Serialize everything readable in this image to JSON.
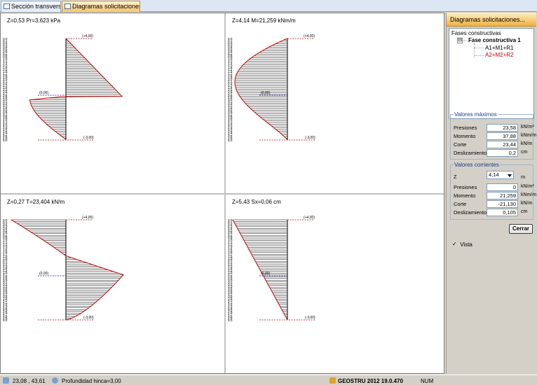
{
  "tabs": [
    {
      "label": "Sección transversal",
      "active": false
    },
    {
      "label": "Diagramas solicitaciones..",
      "active": true
    }
  ],
  "depth_labels": [
    "0,0",
    "0,1",
    "0,2",
    "0,3",
    "0,4",
    "0,5",
    "0,6",
    "0,7",
    "0,8",
    "0,9",
    "1,0",
    "1,1",
    "1,2",
    "1,3",
    "1,4",
    "1,5",
    "1,6",
    "1,7",
    "1,8",
    "1,9",
    "2,0",
    "2,1",
    "2,2",
    "2,3",
    "2,4",
    "2,5",
    "2,6",
    "2,7",
    "2,8",
    "2,9",
    "3,0",
    "3,1",
    "3,2",
    "3,3",
    "3,4",
    "3,5",
    "3,6",
    "3,7",
    "3,8",
    "3,9",
    "4,0",
    "4,1",
    "4,2",
    "4,3",
    "4,4",
    "4,5",
    "4,6",
    "4,7",
    "4,8",
    "4,9",
    "5,0"
  ],
  "diagrams": [
    {
      "title": "Z=0,53 Pr=3,623 kPa",
      "top_marker": "(+4,00)",
      "mid_marker": "(0,00)",
      "bottom_marker": "(-3,00)"
    },
    {
      "title": "Z=4,14 M=21,259 kNm/m",
      "top_marker": "(+4,00)",
      "mid_marker": "(0,00)",
      "bottom_marker": "(-3,00)"
    },
    {
      "title": "Z=0,27 T=23,404 kN/m",
      "top_marker": "(+4,00)",
      "mid_marker": "(0,00)",
      "bottom_marker": "(-3,00)"
    },
    {
      "title": "Z=5,43 Sx=0,06 cm",
      "top_marker": "(+4,00)",
      "mid_marker": "(0,00)",
      "bottom_marker": "(-3,00)"
    }
  ],
  "panel": {
    "title": "Diagramas solicitaciones...",
    "tree": {
      "root": "Fases constructivas",
      "phase": "Fase constructiva 1",
      "items": [
        {
          "label": "A1+M1+R1",
          "color": "#000000"
        },
        {
          "label": "A2+M2+R2",
          "color": "#c00000"
        }
      ],
      "expander": "⊟"
    },
    "max_values": {
      "legend": "Valores máximos",
      "rows": [
        {
          "label": "Presiones",
          "value": "23,58",
          "unit": "kN/m²"
        },
        {
          "label": "Momento",
          "value": "37,88",
          "unit": "kNm/m"
        },
        {
          "label": "Corte",
          "value": "23,44",
          "unit": "kN/m"
        },
        {
          "label": "Deslizamiento",
          "value": "0,2",
          "unit": "cm"
        }
      ]
    },
    "current_values": {
      "legend": "Valores corrientes",
      "z_label": "Z",
      "z_value": "4,14",
      "z_unit": "m",
      "rows": [
        {
          "label": "Presiones",
          "value": "0",
          "unit": "kN/m²"
        },
        {
          "label": "Momento",
          "value": "21,259",
          "unit": "kNm/m"
        },
        {
          "label": "Corte",
          "value": "-21,130",
          "unit": "kN/m"
        },
        {
          "label": "Deslizamiento",
          "value": "0,105",
          "unit": "cm"
        }
      ]
    },
    "close_button": "Cerrar",
    "view_checkbox": {
      "label": "Vista",
      "checked": true,
      "mark": "✓"
    }
  },
  "status": {
    "coords": "23,08 , 43,61",
    "depth": "Profundidad hinca=3,00",
    "app": "GEOSTRU 2012 19.0.470",
    "num": "NUM"
  },
  "colors": {
    "diagram_curve": "#c00000",
    "hatch": "#000000",
    "marker_line": "#c00000",
    "mid_line": "#0000c0"
  }
}
